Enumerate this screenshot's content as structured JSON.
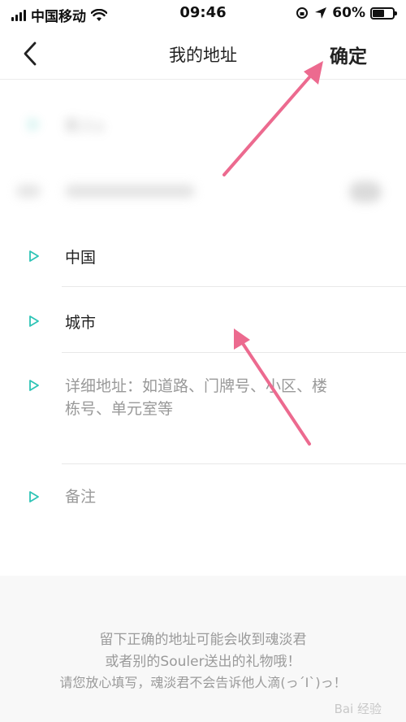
{
  "status_bar": {
    "carrier": "中国移动",
    "time": "09:46",
    "battery_pct": "60%",
    "battery_level": 0.6
  },
  "nav": {
    "title": "我的地址",
    "confirm_label": "确定"
  },
  "fields": {
    "name_partial": "新人s",
    "country": "中国",
    "city": "城市",
    "detail_placeholder_line1": "详细地址：如道路、门牌号、小区、楼",
    "detail_placeholder_line2": "栋号、单元室等",
    "remark_placeholder": "备注"
  },
  "footer": {
    "line1": "留下正确的地址可能会收到魂淡君",
    "line2": "或者别的Souler送出的礼物哦！",
    "line3": "请您放心填写，魂淡君不会告诉他人滴(っ´Ι`)っ！"
  },
  "watermark": "Bai 经验",
  "colors": {
    "accent_teal": "#2ec4b6",
    "annotation_arrow": "#ec6a8f"
  },
  "icons": {
    "back": "chevron-left-icon",
    "row_marker": "play-outline-icon"
  }
}
